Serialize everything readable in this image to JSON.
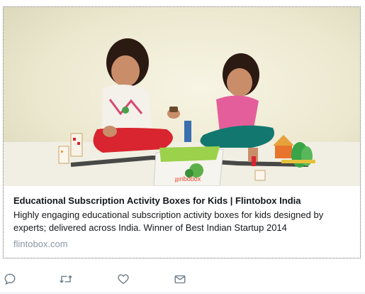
{
  "card": {
    "title": "Educational Subscription Activity Boxes for Kids | Flintobox India",
    "description": "Highly engaging educational subscription activity boxes for kids designed by experts; delivered across India. Winner of Best Indian Startup 2014",
    "domain": "flintobox.com",
    "image": {
      "subject": "two-girls-playing-with-activity-box",
      "box_text": "xoqoquılf"
    }
  },
  "actions": [
    {
      "icon": "reply-icon"
    },
    {
      "icon": "retweet-icon"
    },
    {
      "icon": "like-icon"
    },
    {
      "icon": "direct-message-icon"
    }
  ],
  "colors": {
    "text": "#14171a",
    "muted": "#8b98a4",
    "icon": "#657786",
    "border": "#6b6b6b"
  }
}
